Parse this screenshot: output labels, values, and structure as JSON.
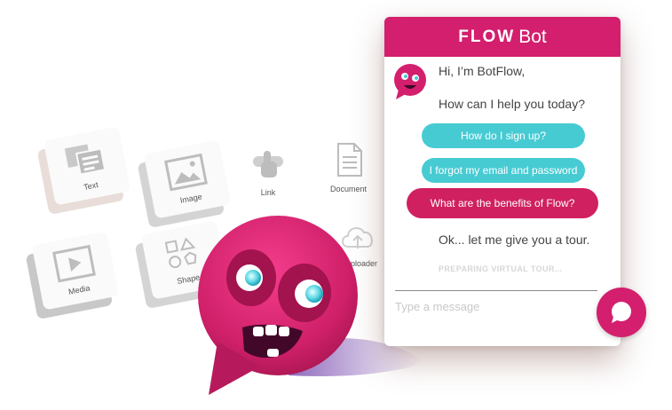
{
  "palette": {
    "accent": "#d31f6d",
    "teal": "#47cbd3",
    "shadow": "#d4d4d4"
  },
  "background_tiles": [
    {
      "label": "Text",
      "icon": "text-doc-icon"
    },
    {
      "label": "Image",
      "icon": "image-icon"
    },
    {
      "label": "Link",
      "icon": "hand-pointer-icon"
    },
    {
      "label": "Document",
      "icon": "document-icon"
    },
    {
      "label": "Media",
      "icon": "play-icon"
    },
    {
      "label": "Shape",
      "icon": "shapes-icon"
    },
    {
      "label": "ploader",
      "icon": "cloud-upload-icon"
    }
  ],
  "chat": {
    "brand_strong": "FLOW",
    "brand_light": "Bot",
    "greeting": "Hi, I’m BotFlow,",
    "prompt": "How can I help you today?",
    "quick_replies": [
      "How do I sign up?",
      "I forgot my email and password",
      "What are the benefits of Flow?"
    ],
    "reply": "Ok... let me give you a tour.",
    "status": "PREPARING VIRTUAL TOUR...",
    "input_placeholder": "Type a message"
  }
}
